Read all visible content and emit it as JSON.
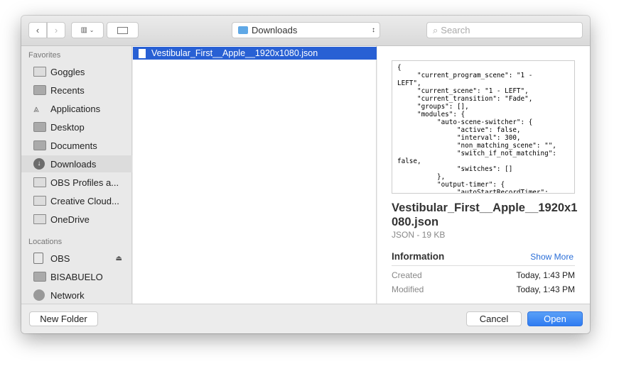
{
  "toolbar": {
    "location": "Downloads",
    "search_placeholder": "Search"
  },
  "sidebar": {
    "favorites_label": "Favorites",
    "favorites": [
      {
        "label": "Goggles",
        "icon": "folder-icon"
      },
      {
        "label": "Recents",
        "icon": "recents-icon"
      },
      {
        "label": "Applications",
        "icon": "applications-icon"
      },
      {
        "label": "Desktop",
        "icon": "desktop-icon"
      },
      {
        "label": "Documents",
        "icon": "documents-icon"
      },
      {
        "label": "Downloads",
        "icon": "downloads-icon",
        "selected": true
      },
      {
        "label": "OBS Profiles a...",
        "icon": "folder-icon"
      },
      {
        "label": "Creative Cloud...",
        "icon": "folder-icon"
      },
      {
        "label": "OneDrive",
        "icon": "folder-icon"
      }
    ],
    "locations_label": "Locations",
    "locations": [
      {
        "label": "OBS",
        "icon": "drive-icon"
      },
      {
        "label": "BISABUELO",
        "icon": "server-icon"
      },
      {
        "label": "Network",
        "icon": "network-icon"
      }
    ]
  },
  "files": [
    {
      "name": "Vestibular_First__Apple__1920x1080.json",
      "selected": true
    }
  ],
  "preview": {
    "code": "{\n     \"current_program_scene\": \"1 -\nLEFT\",\n     \"current_scene\": \"1 - LEFT\",\n     \"current_transition\": \"Fade\",\n     \"groups\": [],\n     \"modules\": {\n          \"auto-scene-switcher\": {\n               \"active\": false,\n               \"interval\": 300,\n               \"non_matching_scene\": \"\",\n               \"switch_if_not_matching\":\nfalse,\n               \"switches\": []\n          },\n          \"output-timer\": {\n               \"autoStartRecordTimer\":",
    "title": "Vestibular_First__Apple__1920x1080.json",
    "subtitle": "JSON - 19 KB",
    "info_label": "Information",
    "show_more": "Show More",
    "created_label": "Created",
    "created_value": "Today, 1:43 PM",
    "modified_label": "Modified",
    "modified_value": "Today, 1:43 PM"
  },
  "buttons": {
    "new_folder": "New Folder",
    "cancel": "Cancel",
    "open": "Open"
  },
  "colors": {
    "accent": "#2860d4",
    "open_button": "#3b86f5"
  }
}
